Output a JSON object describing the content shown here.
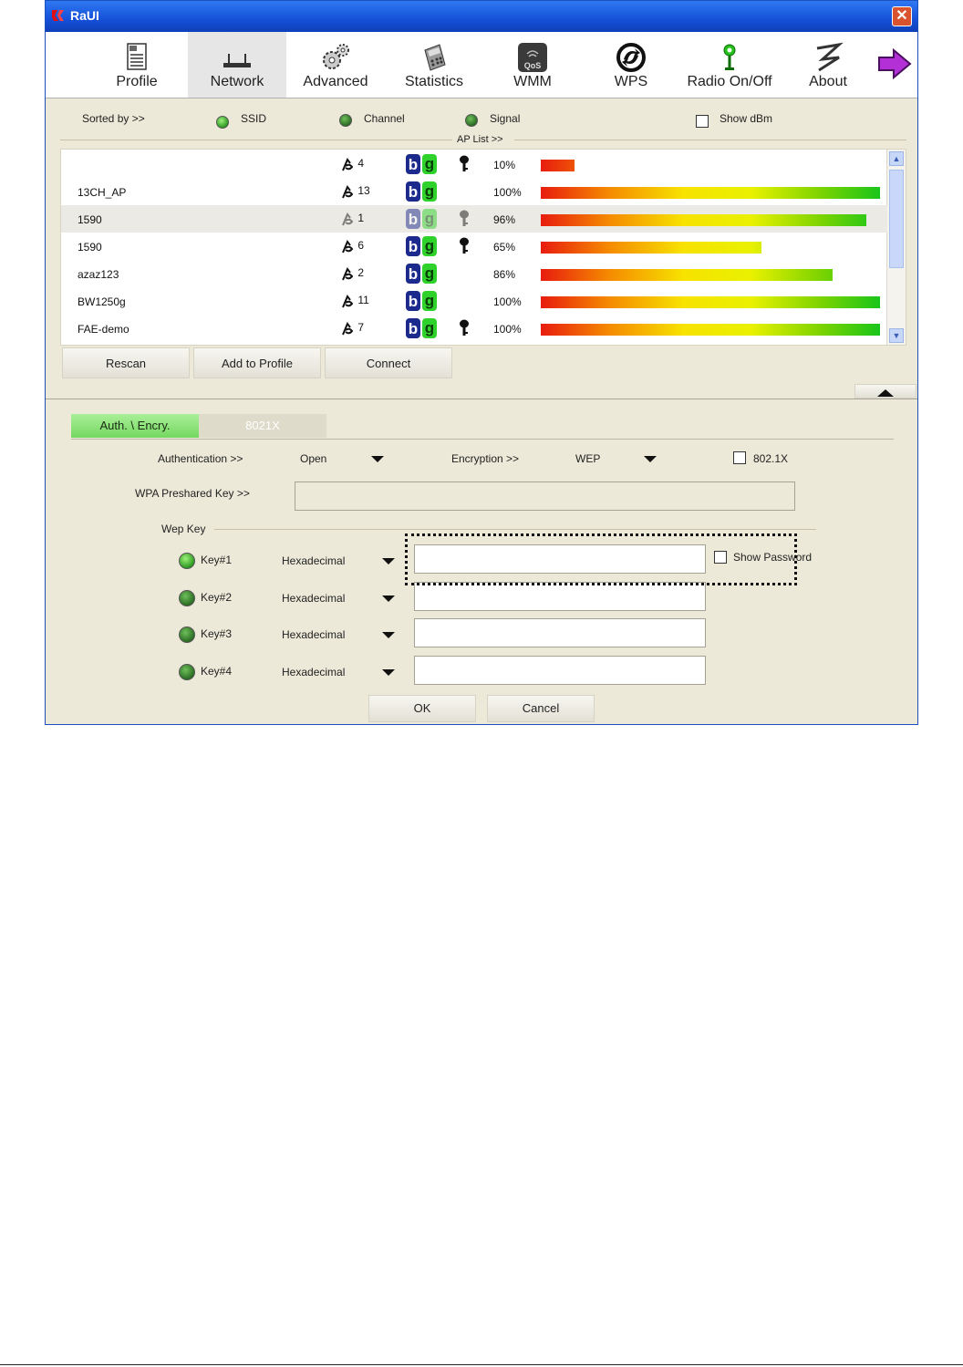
{
  "window": {
    "title": "RaUI"
  },
  "toolbar": [
    {
      "label": "Profile",
      "icon": "profile-icon"
    },
    {
      "label": "Network",
      "icon": "router-icon"
    },
    {
      "label": "Advanced",
      "icon": "gears-icon"
    },
    {
      "label": "Statistics",
      "icon": "calculator-icon"
    },
    {
      "label": "WMM",
      "icon": "qos-icon"
    },
    {
      "label": "WPS",
      "icon": "wps-icon"
    },
    {
      "label": "Radio On/Off",
      "icon": "antenna-icon"
    },
    {
      "label": "About",
      "icon": "about-icon"
    },
    {
      "label": "",
      "icon": "next-arrow-icon"
    }
  ],
  "sort": {
    "label": "Sorted by >>",
    "options": [
      "SSID",
      "Channel",
      "Signal"
    ],
    "show_dbm": "Show dBm",
    "ap_list": "AP List >>"
  },
  "ap_list": [
    {
      "ssid": "",
      "channel": "4",
      "secured": true,
      "signal": "10%",
      "level": 0.1
    },
    {
      "ssid": "13CH_AP",
      "channel": "13",
      "secured": false,
      "signal": "100%",
      "level": 1.0
    },
    {
      "ssid": "1590",
      "channel": "1",
      "secured": true,
      "signal": "96%",
      "level": 0.96,
      "selected": true
    },
    {
      "ssid": "1590",
      "channel": "6",
      "secured": true,
      "signal": "65%",
      "level": 0.65
    },
    {
      "ssid": "azaz123",
      "channel": "2",
      "secured": false,
      "signal": "86%",
      "level": 0.86
    },
    {
      "ssid": "BW1250g",
      "channel": "11",
      "secured": false,
      "signal": "100%",
      "level": 1.0
    },
    {
      "ssid": "FAE-demo",
      "channel": "7",
      "secured": true,
      "signal": "100%",
      "level": 1.0
    }
  ],
  "buttons": {
    "rescan": "Rescan",
    "add_profile": "Add to Profile",
    "connect": "Connect",
    "ok": "OK",
    "cancel": "Cancel"
  },
  "tabs": {
    "auth": "Auth. \\ Encry.",
    "dot1x": "8021X"
  },
  "auth": {
    "auth_label": "Authentication >>",
    "auth_value": "Open",
    "enc_label": "Encryption >>",
    "enc_value": "WEP",
    "dot1x_cb": "802.1X",
    "wpa_label": "WPA Preshared Key >>",
    "wep_label": "Wep Key",
    "show_password": "Show Password"
  },
  "wep_keys": [
    {
      "label": "Key#1",
      "format": "Hexadecimal",
      "value": ""
    },
    {
      "label": "Key#2",
      "format": "Hexadecimal",
      "value": ""
    },
    {
      "label": "Key#3",
      "format": "Hexadecimal",
      "value": ""
    },
    {
      "label": "Key#4",
      "format": "Hexadecimal",
      "value": ""
    }
  ]
}
